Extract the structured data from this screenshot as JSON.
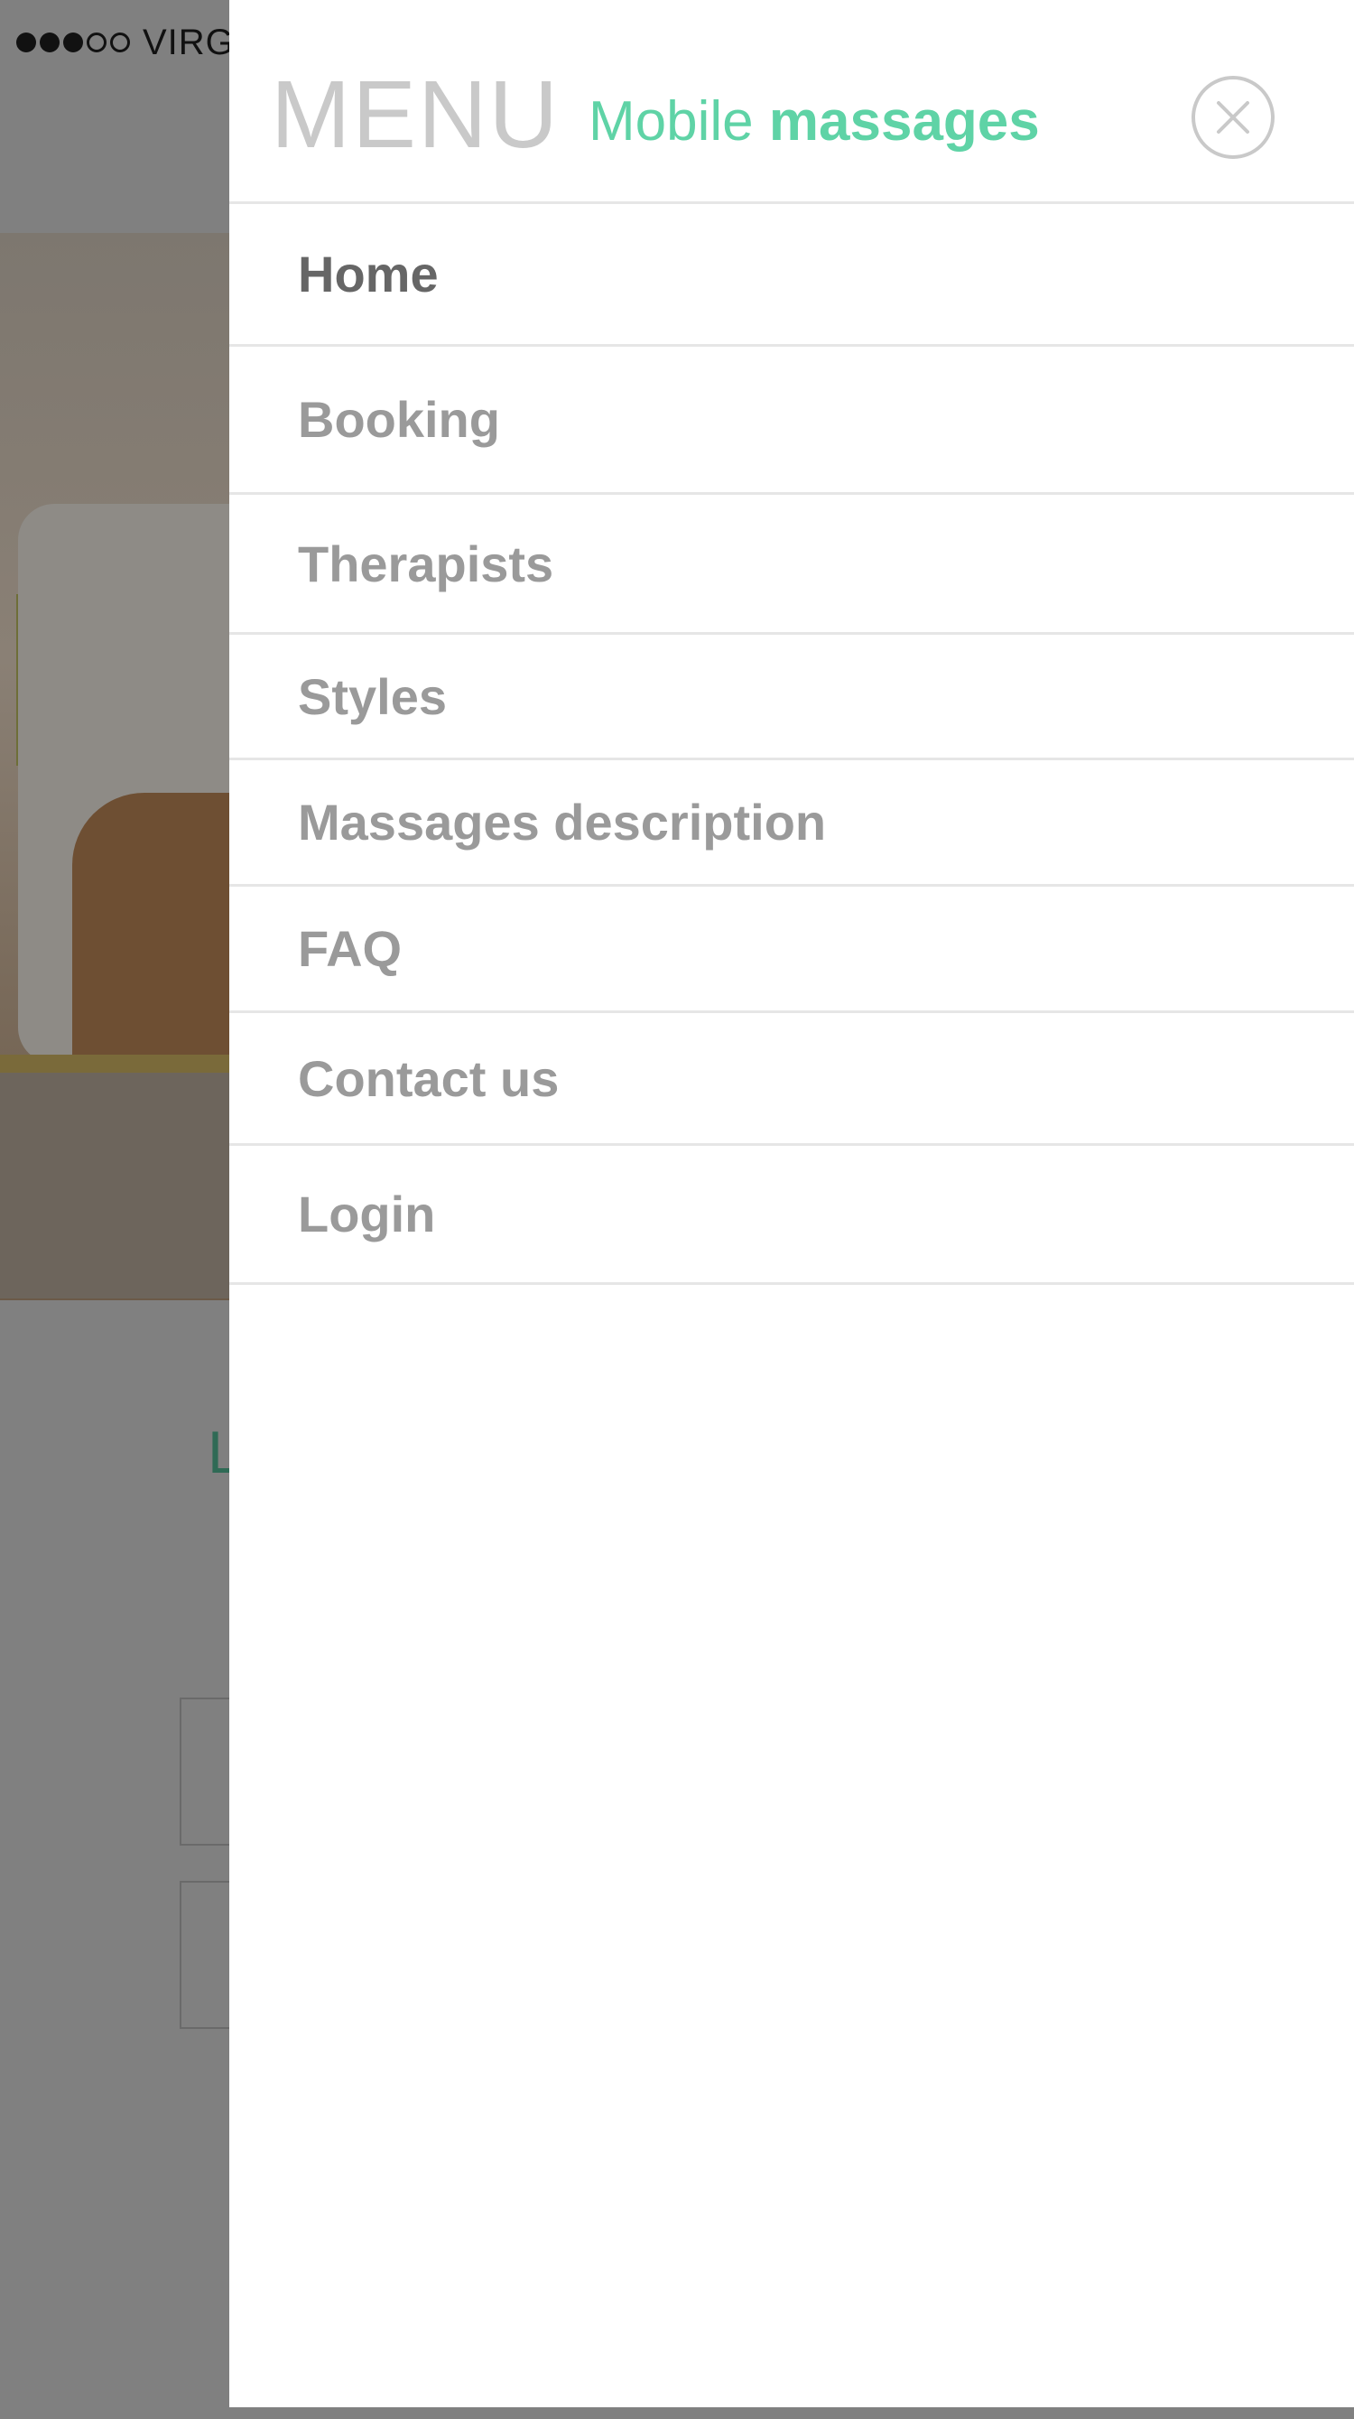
{
  "status_bar": {
    "carrier": "VIRG",
    "signal_bars_filled": 3,
    "signal_bars_total": 5
  },
  "background": {
    "heading_fragment": "L"
  },
  "drawer": {
    "title": "MENU",
    "brand": {
      "light": "Mobile",
      "bold": "massages",
      "color": "#5fd3a6"
    },
    "close_icon": "close-circle-icon",
    "items": [
      {
        "label": "Home",
        "active": true
      },
      {
        "label": "Booking",
        "active": false
      },
      {
        "label": "Therapists",
        "active": false
      },
      {
        "label": "Styles",
        "active": false
      },
      {
        "label": "Massages description",
        "active": false
      },
      {
        "label": "FAQ",
        "active": false
      },
      {
        "label": "Contact us",
        "active": false
      },
      {
        "label": "Login",
        "active": false
      }
    ]
  },
  "colors": {
    "overlay": "#808080",
    "menu_text_active": "#666666",
    "menu_text": "#9a9a9a",
    "divider": "#e6e6e6"
  }
}
